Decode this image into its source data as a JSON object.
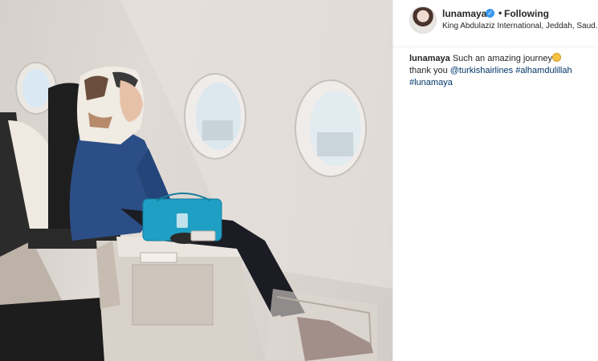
{
  "post": {
    "username": "lunamaya",
    "follow_status": "Following",
    "separator": "•",
    "location": "King Abdulaziz International, Jeddah, Saud..."
  },
  "caption": {
    "username": "lunamaya",
    "text": "Such an amazing journey",
    "emoji": "smiling-face",
    "line2_prefix": "thank you",
    "mention": "@turkishairlines",
    "hashtag1": "#alhamdulillah",
    "hashtag2": "#lunamaya"
  },
  "colors": {
    "link": "#003569",
    "verified": "#3897f0",
    "border": "#efefef",
    "bag": "#1f9fc4",
    "jacket": "#2c4e86"
  },
  "photo": {
    "subject": "woman in hijab seated by airplane window",
    "has_image": true
  }
}
